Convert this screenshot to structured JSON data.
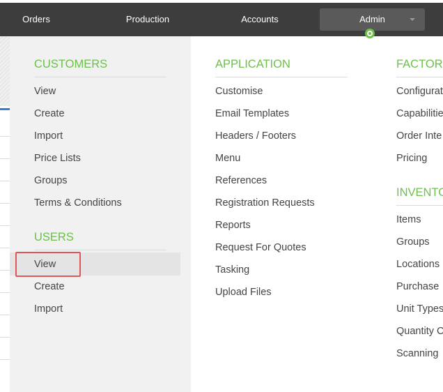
{
  "nav": {
    "items": [
      {
        "label": "Orders"
      },
      {
        "label": "Production"
      },
      {
        "label": "Accounts"
      },
      {
        "label": "Admin"
      }
    ]
  },
  "menu": {
    "customers": {
      "header": "CUSTOMERS",
      "links": [
        "View",
        "Create",
        "Import",
        "Price Lists",
        "Groups",
        "Terms & Conditions"
      ]
    },
    "users": {
      "header": "USERS",
      "links": [
        "View",
        "Create",
        "Import"
      ]
    },
    "application": {
      "header": "APPLICATION",
      "links": [
        "Customise",
        "Email Templates",
        "Headers / Footers",
        "Menu",
        "References",
        "Registration Requests",
        "Reports",
        "Request For Quotes",
        "Tasking",
        "Upload Files"
      ]
    },
    "factory": {
      "header": "FACTORY",
      "links": [
        "Configurat",
        "Capabilitie",
        "Order Inte",
        "Pricing"
      ]
    },
    "inventory": {
      "header": "INVENTO",
      "links": [
        "Items",
        "Groups",
        "Locations",
        "Purchase",
        "Unit Types",
        "Quantity C",
        "Scanning"
      ]
    }
  },
  "colors": {
    "topbar": "#3d3d3d",
    "accent": "#6cc04a",
    "highlight": "#e05555"
  }
}
